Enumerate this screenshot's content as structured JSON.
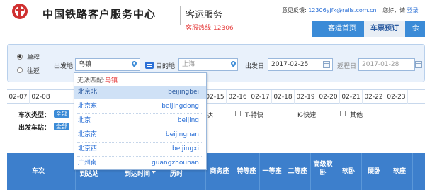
{
  "header": {
    "logo_text": "中国铁路客户服务中心",
    "service_title": "客运服务",
    "hotline": "客服热线:12306",
    "feedback_label": "意见反馈:",
    "feedback_email": "12306yjfk@rails.com.cn",
    "greeting": "您好，请",
    "login": "登录"
  },
  "nav": {
    "home": "客运首页",
    "ticket": "车票预订",
    "more": "余"
  },
  "search": {
    "oneway": "单程",
    "roundtrip": "往返",
    "from_label": "出发地",
    "from_value": "乌镇",
    "to_label": "目的地",
    "to_placeholder": "上海",
    "depart_label": "出发日",
    "depart_value": "2017-02-25",
    "return_label": "返程日",
    "return_value": "2017-01-28"
  },
  "dates": [
    "02-07",
    "02-08",
    "",
    "",
    "",
    "",
    "",
    "",
    "",
    "02-15",
    "02-16",
    "02-17",
    "02-18",
    "02-19",
    "02-20",
    "02-21",
    "02-22",
    "02-23"
  ],
  "filters": {
    "train_type_label": "车次类型：",
    "station_label": "出发车站：",
    "all": "全部",
    "direct_partial": "直达",
    "t_fast": "T-特快",
    "k_fast": "K-快速",
    "other": "其他"
  },
  "dropdown": {
    "head_prefix": "无法匹配:",
    "keyword": "乌镇",
    "items": [
      {
        "cn": "北京北",
        "py": "beijingbei"
      },
      {
        "cn": "北京东",
        "py": "beijingdong"
      },
      {
        "cn": "北京",
        "py": "beijing"
      },
      {
        "cn": "北京南",
        "py": "beijingnan"
      },
      {
        "cn": "北京西",
        "py": "beijingxi"
      },
      {
        "cn": "广州南",
        "py": "guangzhounan"
      }
    ]
  },
  "table_header": {
    "train": "车次",
    "arrive_station": "到达站",
    "arrive_time": "到达时间",
    "duration": "历时",
    "business": "商务座",
    "special": "特等座",
    "first": "一等座",
    "second": "二等座",
    "senior_soft": "高级软卧",
    "soft_sleeper": "软卧",
    "hard_sleeper": "硬卧",
    "soft_seat": "软座"
  },
  "colors": {
    "accent": "#3b8bd7",
    "hotline": "#e64040",
    "link": "#2a6fd6"
  }
}
